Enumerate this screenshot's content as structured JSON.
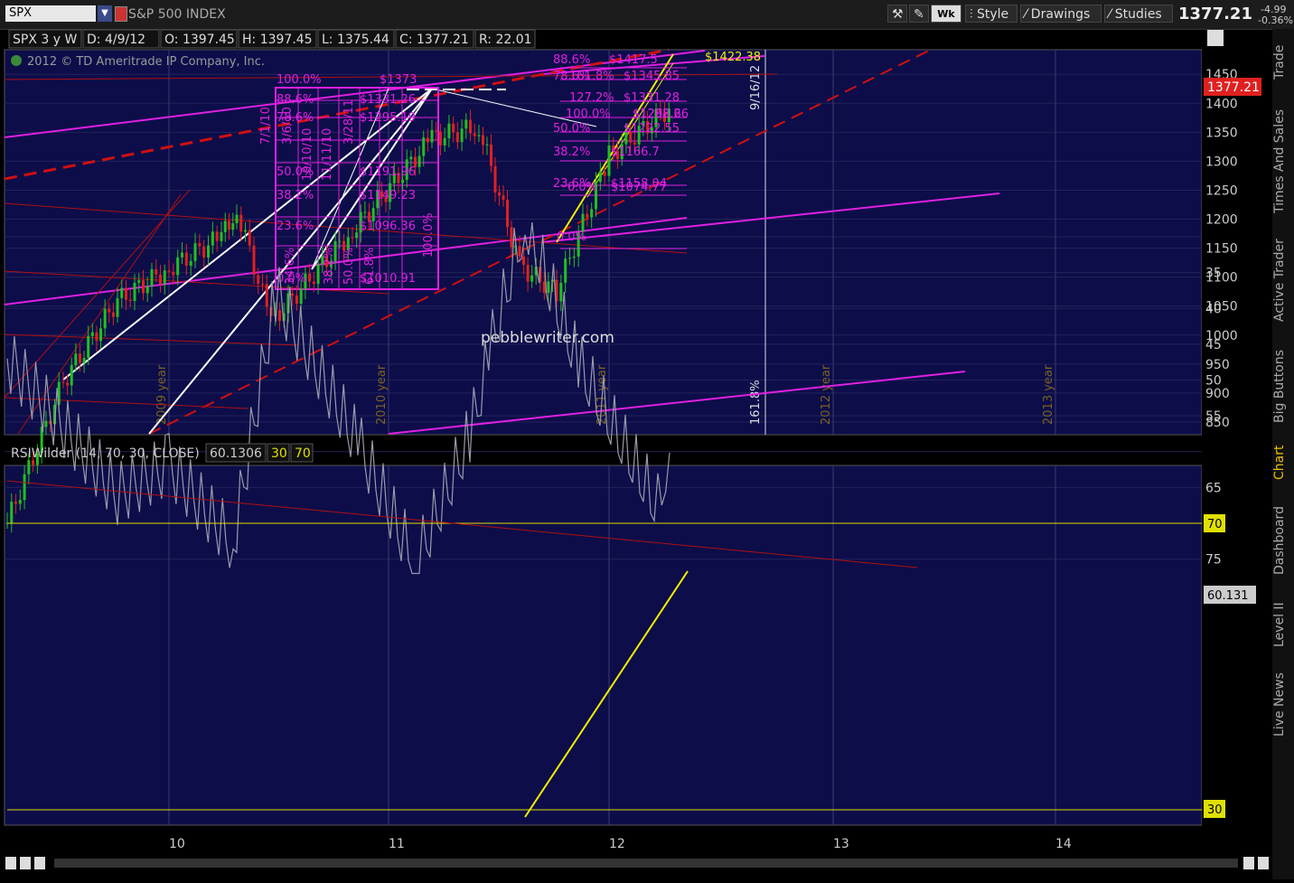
{
  "toolbar": {
    "symbol": "SPX",
    "symbol_name": "S&P 500 INDEX",
    "period_button": "Wk",
    "style_label": "Style",
    "drawings_label": "Drawings",
    "studies_label": "Studies",
    "last_price": "1377.21",
    "change": "-4.99",
    "change_pct": "-0.36%"
  },
  "sidebar": {
    "tabs": [
      "Trade",
      "Times And Sales",
      "Active Trader",
      "Big Buttons",
      "Chart",
      "Dashboard",
      "Level II",
      "Live News"
    ],
    "active": "Chart"
  },
  "price_panel": {
    "header": {
      "name": "SPX 3 y W",
      "date": "D: 4/9/12",
      "open": "O: 1397.45",
      "high": "H: 1397.45",
      "low": "L: 1375.44",
      "close": "C: 1377.21",
      "range": "R: 22.01"
    },
    "copyright": "2012 © TD Ameritrade IP Company, Inc.",
    "watermark": "pebblewriter.com",
    "price_tag": "1377.21",
    "y_ticks": [
      "1450",
      "1400",
      "1350",
      "1300",
      "1250",
      "1200",
      "1150",
      "1100",
      "1050",
      "1000",
      "950",
      "900",
      "850"
    ],
    "year_labels": [
      "2009 year",
      "2010 year",
      "2011 year",
      "2012 year",
      "2013 year"
    ],
    "date_label": "9/16/12",
    "fib_ext_label": "161.8%",
    "fib_box_left": {
      "levels": [
        "100.0%",
        "88.6%",
        "78.6%",
        "50.0%",
        "38.2%",
        "23.6%",
        "0.0%"
      ],
      "prices": [
        "$1373",
        "$1331.26",
        "$1295.19",
        "$1191.96",
        "$1149.23",
        "$1096.36",
        "$1010.91"
      ],
      "verticals": [
        "7/1/10",
        "3/6/10",
        "10/10/10",
        "11/11/10",
        "3/28/11",
        "34.6%",
        "38.2%",
        "50.0%",
        "61.8%",
        "100.0%"
      ]
    },
    "fib_box_right": {
      "levels": [
        "88.6%",
        "78.6%",
        "161.8%",
        "127.2%",
        "100.0%",
        "50.0%",
        "38.2%",
        "23.6%",
        "0.0%",
        "0.0%"
      ],
      "prices": [
        "$1417.5",
        "$1345.85",
        "$1331.28",
        "$1292.66",
        "$1268.2",
        "$1222.55",
        "$1166.7",
        "$1158.04",
        "$1074.77",
        "$1422.38"
      ]
    }
  },
  "rsi_panel": {
    "header": "RSIWilder (14, 70, 30, CLOSE)",
    "value": "60.1306",
    "ob": "30",
    "os": "70",
    "value_tag": "60.131",
    "tag_70": "70",
    "tag_30": "30",
    "y_ticks": [
      "75",
      "70",
      "65",
      "60",
      "55",
      "50",
      "45",
      "40",
      "35",
      "30"
    ]
  },
  "x_axis": {
    "ticks": [
      "10",
      "11",
      "12",
      "13",
      "14"
    ]
  },
  "chart_data": {
    "type": "line",
    "title": "SPX 3 y W",
    "series": [
      {
        "name": "SPX",
        "x": [
          "2009-03",
          "2009-06",
          "2009-09",
          "2009-12",
          "2010-03",
          "2010-04",
          "2010-07",
          "2010-10",
          "2011-02",
          "2011-05",
          "2011-08",
          "2011-10",
          "2012-01",
          "2012-04"
        ],
        "values": [
          676,
          920,
          1060,
          1115,
          1170,
          1217,
          1022,
          1180,
          1340,
          1360,
          1120,
          1075,
          1310,
          1397
        ]
      },
      {
        "name": "RSIWilder (14, 70, 30, CLOSE)",
        "x": [
          "2009-03",
          "2009-06",
          "2009-12",
          "2010-04",
          "2010-07",
          "2010-10",
          "2011-02",
          "2011-05",
          "2011-08",
          "2011-10",
          "2012-01",
          "2012-03",
          "2012-04"
        ],
        "values": [
          47,
          66,
          62,
          73,
          38,
          60,
          76,
          58,
          45,
          28,
          48,
          68,
          60.13
        ]
      }
    ],
    "ylim_price": [
      820,
      1460
    ],
    "ylim_rsi": [
      28,
      78
    ],
    "grid": true
  }
}
